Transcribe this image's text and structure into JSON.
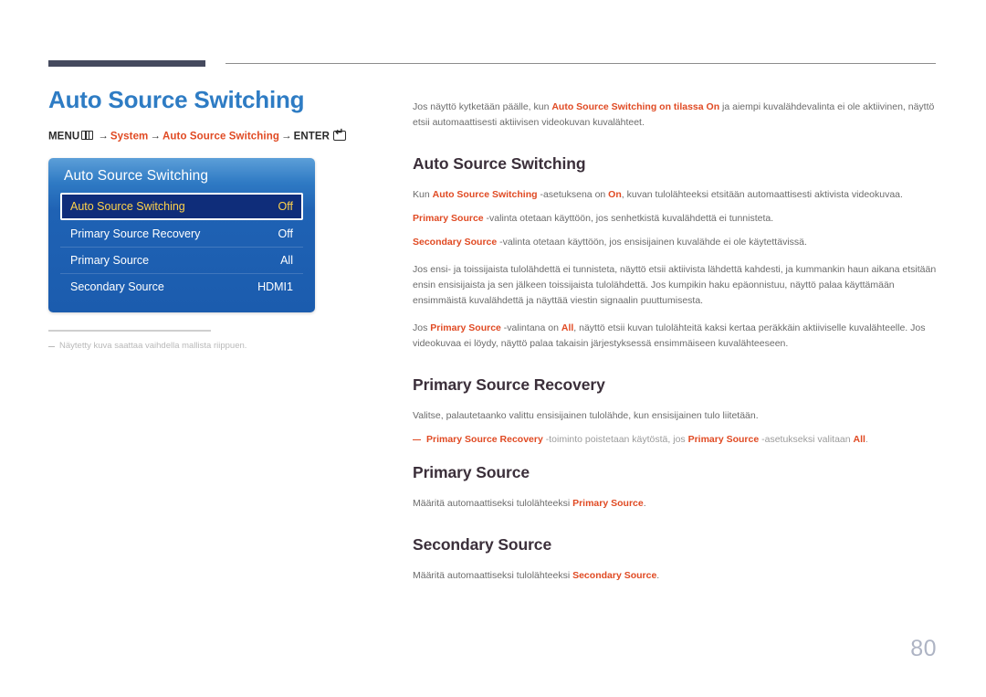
{
  "page": {
    "number": "80"
  },
  "left": {
    "title": "Auto Source Switching",
    "breadcrumb": {
      "menu_label": "MENU",
      "menu_icon": "menu-grid-icon",
      "arrow": "→",
      "item1": "System",
      "item2": "Auto Source Switching",
      "enter_label": "ENTER",
      "enter_icon": "enter-key-icon"
    },
    "osd": {
      "header": "Auto Source Switching",
      "rows": [
        {
          "label": "Auto Source Switching",
          "value": "Off",
          "selected": true
        },
        {
          "label": "Primary Source Recovery",
          "value": "Off",
          "selected": false
        },
        {
          "label": "Primary Source",
          "value": "All",
          "selected": false
        },
        {
          "label": "Secondary Source",
          "value": "HDMI1",
          "selected": false
        }
      ]
    },
    "footnote": "Näytetty kuva saattaa vaihdella mallista riippuen."
  },
  "right": {
    "intro": {
      "part1": "Jos näyttö kytketään päälle, kun ",
      "accent1": "Auto Source Switching on tilassa On",
      "part2": " ja aiempi kuvalähdevalinta ei ole aktiivinen, näyttö etsii automaattisesti aktiivisen videokuvan kuvalähteet."
    },
    "sections": [
      {
        "heading": "Auto Source Switching",
        "p1": {
          "a": "Kun ",
          "b": "Auto Source Switching",
          "c": " -asetuksena on ",
          "d": "On",
          "e": ", kuvan tulolähteeksi etsitään automaattisesti aktivista videokuvaa."
        },
        "p2": {
          "a": "Primary Source",
          "b": " -valinta otetaan käyttöön, jos senhetkistä kuvalähdettä ei tunnisteta."
        },
        "p3": {
          "a": "Secondary Source",
          "b": " -valinta otetaan käyttöön, jos ensisijainen kuvalähde ei ole käytettävissä."
        },
        "p4": "Jos ensi- ja toissijaista tulolähdettä ei tunnisteta, näyttö etsii aktiivista lähdettä kahdesti, ja kummankin haun aikana etsitään ensin ensisijaista ja sen jälkeen toissijaista tulolähdettä. Jos kumpikin haku epäonnistuu, näyttö palaa käyttämään ensimmäistä kuvalähdettä ja näyttää viestin signaalin puuttumisesta.",
        "p5": {
          "a": "Jos ",
          "b": "Primary Source",
          "c": " -valintana on ",
          "d": "All",
          "e": ", näyttö etsii kuvan tulolähteitä kaksi kertaa peräkkäin aktiiviselle kuvalähteelle. Jos videokuvaa ei löydy, näyttö palaa takaisin järjestyksessä ensimmäiseen kuvalähteeseen."
        }
      },
      {
        "heading": "Primary Source Recovery",
        "p1": "Valitse, palautetaanko valittu ensisijainen tulolähde, kun ensisijainen tulo liitetään.",
        "note": {
          "a": "Primary Source Recovery",
          "b": " -toiminto poistetaan käytöstä, jos ",
          "c": "Primary Source",
          "d": " -asetukseksi valitaan ",
          "e": "All",
          "f": "."
        }
      },
      {
        "heading": "Primary Source",
        "p1": {
          "a": "Määritä automaattiseksi tulolähteeksi ",
          "b": "Primary Source",
          "c": "."
        }
      },
      {
        "heading": "Secondary Source",
        "p1": {
          "a": "Määritä automaattiseksi tulolähteeksi ",
          "b": "Secondary Source",
          "c": "."
        }
      }
    ]
  },
  "colors": {
    "title_blue": "#2e7cc4",
    "accent_orange": "#e04a23",
    "heading_dark": "#3b2f3a",
    "osd_blue": "#1f62b4",
    "osd_selected_bg": "#0f2d7a",
    "osd_selected_text": "#ffd24a"
  }
}
